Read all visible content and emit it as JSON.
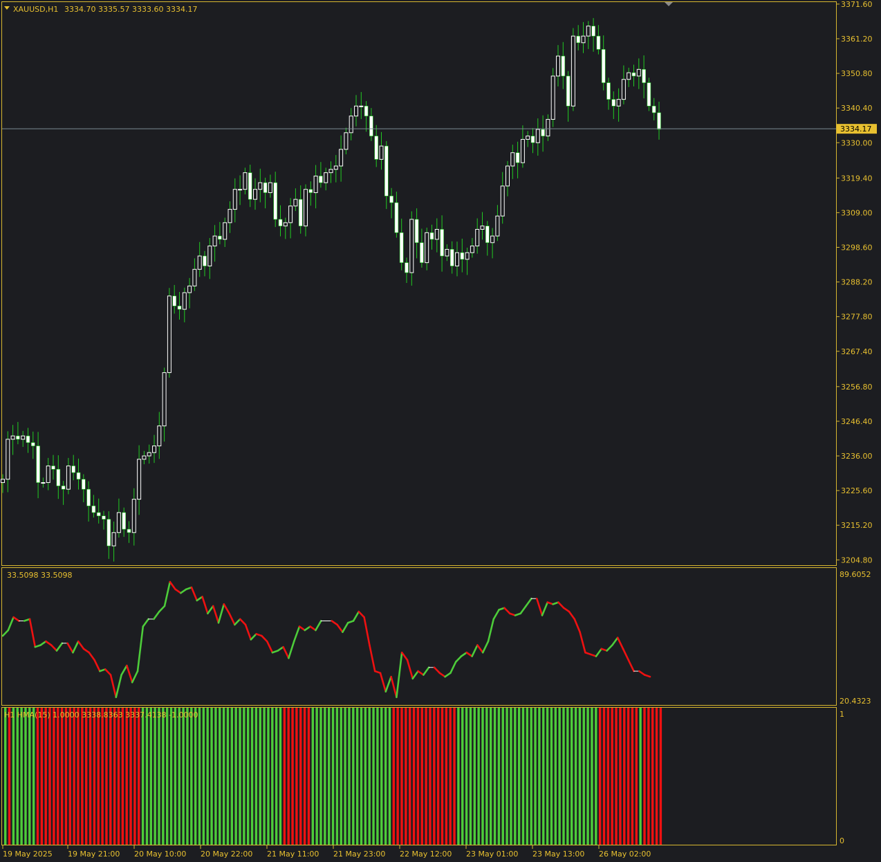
{
  "main_panel": {
    "symbol": "XAUUSD,H1",
    "ohlc": "3334.70 3335.57 3333.60 3334.17",
    "current_price": "3334.17"
  },
  "indicator_panel": {
    "header": "33.5098 33.5098",
    "scale_max": "89.6052",
    "scale_min": "20.4323"
  },
  "histogram_panel": {
    "header": "H1 HMA(15) 1.0000 3338.8363 3337.4138 -1.0000",
    "scale_top": "1",
    "scale_bottom": "0"
  },
  "time_axis": [
    "19 May 2025",
    "19 May 21:00",
    "20 May 10:00",
    "20 May 22:00",
    "21 May 11:00",
    "21 May 23:00",
    "22 May 12:00",
    "23 May 01:00",
    "23 May 13:00",
    "26 May 02:00"
  ],
  "colors": {
    "bull": "#4dcc3a",
    "bear": "#ee1111",
    "neutral": "#ffffff",
    "candle_body": "#ffffff",
    "wick": "#22cc22",
    "axis_text": "#e8c030",
    "frame": "#d9b830",
    "background": "#1c1d21"
  },
  "chart_data": [
    {
      "type": "candlestick",
      "title": "XAUUSD,H1",
      "y_ticks": [
        3371.6,
        3361.2,
        3350.8,
        3340.4,
        3330.0,
        3319.4,
        3309.0,
        3298.6,
        3288.2,
        3277.8,
        3267.4,
        3256.8,
        3246.4,
        3236.0,
        3225.6,
        3215.2,
        3204.8
      ],
      "ylim": [
        3203.2,
        3372.2
      ],
      "current_price": 3334.17,
      "close": [
        3229,
        3241,
        3242,
        3241,
        3242,
        3240,
        3239,
        3228,
        3228,
        3233,
        3232,
        3227,
        3226,
        3233,
        3231,
        3229,
        3226,
        3221,
        3219,
        3218,
        3217,
        3209,
        3213,
        3219,
        3214,
        3213,
        3223,
        3235,
        3236,
        3237,
        3239,
        3245,
        3261,
        3284,
        3281,
        3280,
        3285,
        3287,
        3292,
        3296,
        3293,
        3299,
        3302,
        3301,
        3306,
        3310,
        3316,
        3316,
        3321,
        3313,
        3316,
        3318,
        3315,
        3318,
        3307,
        3305,
        3306,
        3311,
        3313,
        3305,
        3316,
        3315,
        3320,
        3318,
        3321,
        3322,
        3323,
        3328,
        3333,
        3338,
        3341,
        3341,
        3338,
        3332,
        3325,
        3329,
        3314,
        3312,
        3303,
        3294,
        3291,
        3307,
        3300,
        3294,
        3303,
        3301,
        3304,
        3296,
        3298,
        3293,
        3297,
        3295,
        3297,
        3299,
        3304,
        3305,
        3300,
        3302,
        3308,
        3317,
        3323,
        3327,
        3324,
        3331,
        3332,
        3330,
        3334,
        3332,
        3337,
        3350,
        3356,
        3350,
        3341,
        3362,
        3360,
        3362,
        3365,
        3362,
        3358,
        3348,
        3343,
        3341,
        3343,
        3349,
        3351,
        3350,
        3352,
        3348,
        3341,
        3339,
        3334
      ]
    },
    {
      "type": "line",
      "title": "33.5098 33.5098",
      "ylim": [
        20.4323,
        89.6052
      ],
      "values": [
        55,
        58,
        65,
        63,
        63,
        64,
        49,
        50,
        52,
        50,
        47,
        51,
        51,
        46,
        52,
        48,
        46,
        42,
        36,
        37,
        34,
        22,
        34,
        39,
        30,
        36,
        60,
        64,
        64,
        68,
        71,
        84,
        80,
        78,
        80,
        81,
        74,
        76,
        67,
        71,
        62,
        72,
        67,
        61,
        64,
        61,
        53,
        56,
        55,
        52,
        46,
        47,
        49,
        43,
        52,
        60,
        58,
        60,
        58,
        63,
        63,
        63,
        61,
        57,
        62,
        63,
        68,
        65,
        50,
        36,
        35,
        25,
        33,
        22,
        46,
        42,
        32,
        36,
        34,
        38,
        38,
        35,
        33,
        35,
        41,
        44,
        46,
        44,
        50,
        46,
        52,
        64,
        69,
        70,
        67,
        66,
        67,
        71,
        75,
        75,
        66,
        73,
        72,
        73,
        70,
        68,
        64,
        57,
        46,
        45,
        44,
        48,
        47,
        50,
        54,
        48,
        42,
        36,
        36,
        34,
        33
      ]
    },
    {
      "type": "bar",
      "title": "H1 HMA(15) 1.0000 3338.8363 3337.4138 -1.0000",
      "ylim": [
        0,
        1
      ],
      "trend": [
        1,
        -1,
        1,
        1,
        1,
        1,
        1,
        1,
        -1,
        -1,
        -1,
        -1,
        -1,
        -1,
        -1,
        -1,
        -1,
        -1,
        -1,
        -1,
        -1,
        -1,
        -1,
        -1,
        -1,
        -1,
        -1,
        -1,
        -1,
        -1,
        -1,
        -1,
        -1,
        -1,
        1,
        1,
        1,
        1,
        1,
        1,
        1,
        1,
        1,
        1,
        1,
        1,
        1,
        1,
        1,
        1,
        1,
        1,
        1,
        1,
        1,
        1,
        1,
        1,
        1,
        1,
        1,
        1,
        1,
        1,
        1,
        1,
        1,
        1,
        1,
        -1,
        -1,
        -1,
        -1,
        -1,
        -1,
        -1,
        1,
        1,
        1,
        1,
        1,
        1,
        1,
        1,
        1,
        1,
        1,
        1,
        1,
        1,
        1,
        1,
        1,
        1,
        1,
        1,
        -1,
        -1,
        -1,
        -1,
        -1,
        -1,
        -1,
        -1,
        -1,
        -1,
        -1,
        -1,
        -1,
        -1,
        -1,
        -1,
        1,
        1,
        1,
        1,
        1,
        1,
        1,
        1,
        1,
        1,
        1,
        1,
        1,
        1,
        1,
        1,
        1,
        1,
        1,
        1,
        1,
        1,
        1,
        1,
        1,
        1,
        1,
        1,
        1,
        1,
        1,
        1,
        1,
        1,
        1,
        -1,
        -1,
        -1,
        -1,
        -1,
        -1,
        -1,
        -1,
        -1,
        -1,
        1,
        -1,
        -1,
        -1,
        -1,
        -1
      ]
    }
  ]
}
